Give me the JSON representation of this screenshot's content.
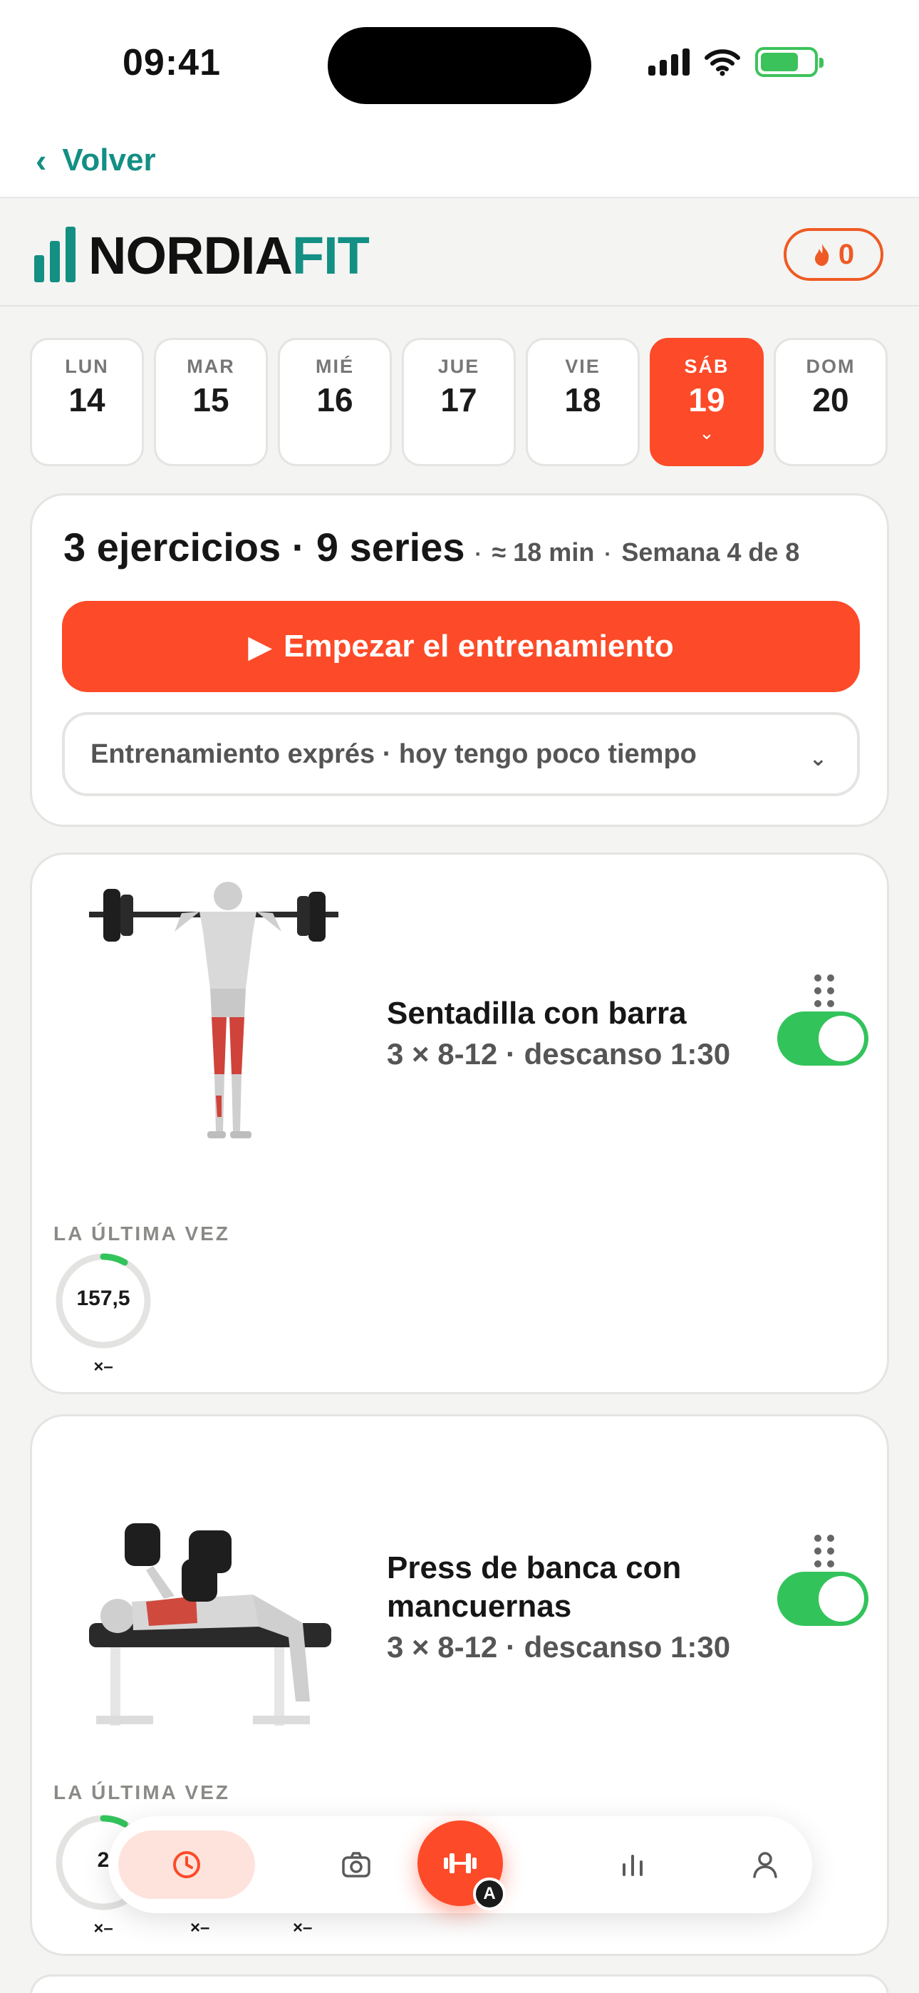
{
  "status": {
    "time": "09:41"
  },
  "nav": {
    "back_label": "Volver"
  },
  "brand": {
    "name_a": "NORDIA",
    "name_b": "FIT",
    "streak_count": "0"
  },
  "days": [
    {
      "name": "LUN",
      "num": "14"
    },
    {
      "name": "MAR",
      "num": "15"
    },
    {
      "name": "MIÉ",
      "num": "16"
    },
    {
      "name": "JUE",
      "num": "17"
    },
    {
      "name": "VIE",
      "num": "18"
    },
    {
      "name": "SÁB",
      "num": "19",
      "active": true
    },
    {
      "name": "DOM",
      "num": "20"
    }
  ],
  "summary": {
    "main": "3 ejercicios · 9 series",
    "duration": "≈ 18 min",
    "week": "Semana 4 de 8",
    "start_button": "Empezar el entrenamiento",
    "express_label": "Entrenamiento exprés · hoy tengo poco tiempo"
  },
  "exercises": [
    {
      "title": "Sentadilla con barra",
      "detail": "3 × 8-12 · descanso 1:30",
      "enabled": true,
      "last_label": "LA ÚLTIMA VEZ",
      "last_value": "157,5",
      "last_reps": "×–"
    },
    {
      "title": "Press de banca con mancuernas",
      "detail": "3 × 8-12 · descanso 1:30",
      "enabled": true,
      "last_label": "LA ÚLTIMA VEZ",
      "last_value": "2",
      "last_reps": "×–",
      "extra_reps": [
        "×–",
        "×–"
      ]
    }
  ],
  "tabbar": {
    "items": [
      "history-icon",
      "camera-icon",
      "dumbbell-icon",
      "stats-icon",
      "profile-icon"
    ],
    "center_badge": "A"
  },
  "colors": {
    "accent": "#fd4a28",
    "brand": "#138f84",
    "toggle_on": "#33c35b"
  }
}
